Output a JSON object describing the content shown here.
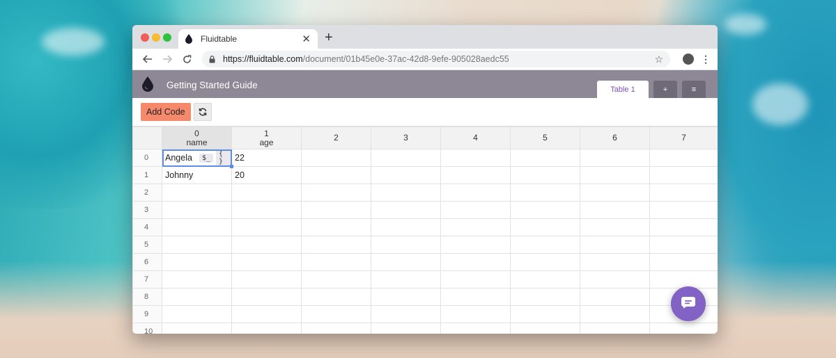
{
  "browser": {
    "tab_title": "Fluidtable",
    "url_host": "https://fluidtable.com",
    "url_path": "/document/01b45e0e-37ac-42d8-9efe-905028aedc55",
    "new_tab_label": "+",
    "tab_close_label": "✕"
  },
  "app": {
    "title": "Getting Started Guide",
    "sheet_tabs": {
      "active": "Table 1",
      "add": "+",
      "menu": "≡"
    },
    "actions": {
      "add_code": "Add Code"
    }
  },
  "grid": {
    "columns": [
      {
        "index": "0",
        "name": "name"
      },
      {
        "index": "1",
        "name": "age"
      },
      {
        "index": "2",
        "name": ""
      },
      {
        "index": "3",
        "name": ""
      },
      {
        "index": "4",
        "name": ""
      },
      {
        "index": "5",
        "name": ""
      },
      {
        "index": "6",
        "name": ""
      },
      {
        "index": "7",
        "name": ""
      }
    ],
    "rows": [
      {
        "num": "0",
        "cells": [
          "Angela",
          "22"
        ]
      },
      {
        "num": "1",
        "cells": [
          "Johnny",
          "20"
        ]
      },
      {
        "num": "2",
        "cells": [
          "",
          ""
        ]
      },
      {
        "num": "3",
        "cells": [
          "",
          ""
        ]
      },
      {
        "num": "4",
        "cells": [
          "",
          ""
        ]
      },
      {
        "num": "5",
        "cells": [
          "",
          ""
        ]
      },
      {
        "num": "6",
        "cells": [
          "",
          ""
        ]
      },
      {
        "num": "7",
        "cells": [
          "",
          ""
        ]
      },
      {
        "num": "8",
        "cells": [
          "",
          ""
        ]
      },
      {
        "num": "9",
        "cells": [
          "",
          ""
        ]
      },
      {
        "num": "10",
        "cells": [
          "",
          ""
        ]
      }
    ],
    "cell_chips": {
      "shell": "$_",
      "braces": "{ }"
    }
  },
  "colors": {
    "header_bg": "#8e8896",
    "accent": "#7b4fb5",
    "add_code_bg": "#f4896b",
    "selection": "#5b8de8",
    "chat_fab": "#8262c4"
  },
  "icons": [
    "back-icon",
    "forward-icon",
    "reload-icon",
    "lock-icon",
    "star-icon",
    "profile-icon",
    "kebab-menu-icon",
    "droplet-logo-icon",
    "refresh-icon",
    "chat-icon"
  ]
}
